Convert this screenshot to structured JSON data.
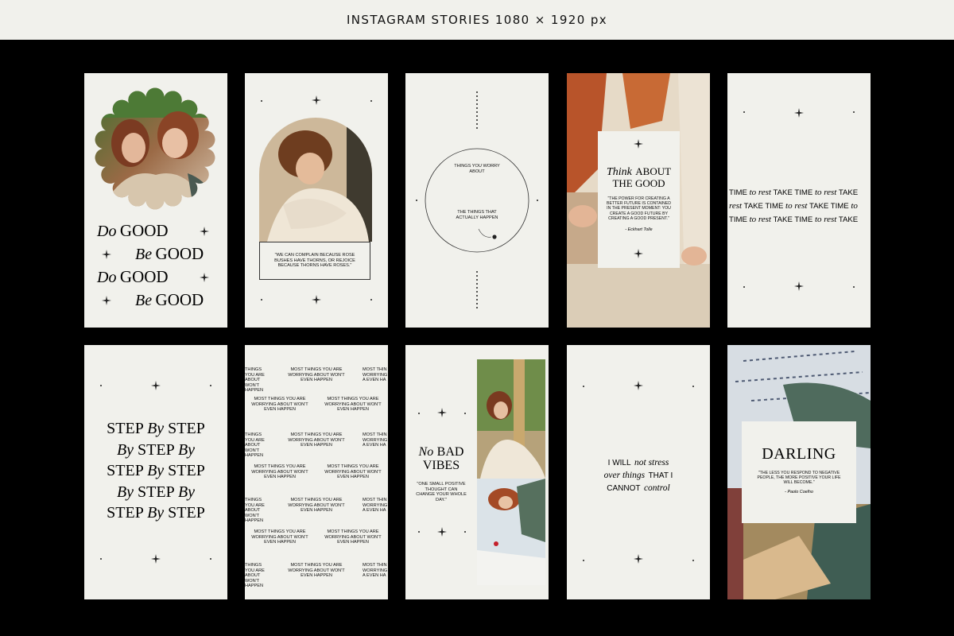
{
  "header": {
    "title": "INSTAGRAM STORIES 1080 × 1920 px"
  },
  "card1": {
    "line1_script": "Do",
    "line1_word": "GOOD",
    "line2_script": "Be",
    "line2_word": "GOOD",
    "line3_script": "Do",
    "line3_word": "GOOD",
    "line4_script": "Be",
    "line4_word": "GOOD"
  },
  "card2": {
    "quote": "\"WE CAN COMPLAIN BECAUSE ROSE BUSHES HAVE THORNS, OR REJOICE BECAUSE THORNS HAVE ROSES.\""
  },
  "card3": {
    "outer_label": "THINGS YOU WORRY ABOUT",
    "inner_label": "THE THINGS THAT ACTUALLY HAPPEN"
  },
  "card4": {
    "title_script": "Think",
    "title_line1": "ABOUT",
    "title_line2": "THE GOOD",
    "quote": "\"THE POWER FOR CREATING A BETTER FUTURE IS CONTAINED IN THE PRESENT MOMENT: YOU CREATE A GOOD FUTURE BY CREATING A GOOD PRESENT.\"",
    "author": "- Eckhart Tolle"
  },
  "card5": {
    "rows": [
      [
        "TIME",
        "to rest",
        "TAKE TIME",
        "to rest",
        "TAKE"
      ],
      [
        "rest",
        "TAKE TIME",
        "to rest",
        "TAKE TIME",
        "to"
      ],
      [
        "TIME",
        "to rest",
        "TAKE TIME",
        "to rest",
        "TAKE"
      ]
    ]
  },
  "card6": {
    "rows": [
      [
        "STEP",
        "By",
        "STEP"
      ],
      [
        "By",
        "STEP",
        "By"
      ],
      [
        "STEP",
        "By",
        "STEP"
      ],
      [
        "By",
        "STEP",
        "By"
      ],
      [
        "STEP",
        "By",
        "STEP"
      ]
    ]
  },
  "card7": {
    "full": "MOST THINGS YOU ARE WORRYING ABOUT WON'T EVEN HAPPEN",
    "left_cut": "THINGS YOU ARE ABOUT WON'T HAPPEN",
    "right_cut": "MOST THIN WORRYING A EVEN HA"
  },
  "card8": {
    "title_script": "No",
    "title_line1": "BAD",
    "title_line2": "VIBES",
    "quote": "\"ONE SMALL POSITIVE THOUGHT CAN CHANGE YOUR WHOLE DAY.\""
  },
  "card9": {
    "l1a": "I WILL",
    "l1b": "not stress",
    "l2a": "over things",
    "l2b": "THAT I",
    "l3a": "CANNOT",
    "l3b": "control"
  },
  "card10": {
    "title": "DARLING",
    "quote": "\"THE LESS YOU RESPOND TO NEGATIVE PEOPLE, THE MORE POSITIVE YOUR LIFE WILL BECOME.\"",
    "author": "- Paolo Coelho"
  },
  "colors": {
    "background": "#000000",
    "card": "#f1f1ec",
    "ink": "#111111"
  }
}
